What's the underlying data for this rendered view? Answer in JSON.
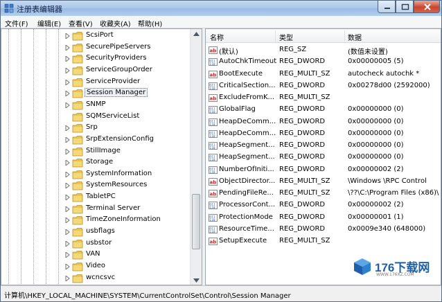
{
  "window": {
    "title": "注册表编辑器"
  },
  "menu": [
    "文件(F)",
    "编辑(E)",
    "查看(V)",
    "收藏夹(A)",
    "帮助(H)"
  ],
  "tree": {
    "selected": "Session Manager",
    "items": [
      {
        "label": "ScsiPort",
        "expandable": true
      },
      {
        "label": "SecurePipeServers",
        "expandable": true
      },
      {
        "label": "SecurityProviders",
        "expandable": true
      },
      {
        "label": "ServiceGroupOrder",
        "expandable": true
      },
      {
        "label": "ServiceProvider",
        "expandable": true
      },
      {
        "label": "Session Manager",
        "expandable": true
      },
      {
        "label": "SNMP",
        "expandable": true
      },
      {
        "label": "SQMServiceList",
        "expandable": false
      },
      {
        "label": "Srp",
        "expandable": true
      },
      {
        "label": "SrpExtensionConfig",
        "expandable": true
      },
      {
        "label": "StillImage",
        "expandable": true
      },
      {
        "label": "Storage",
        "expandable": true
      },
      {
        "label": "SystemInformation",
        "expandable": true
      },
      {
        "label": "SystemResources",
        "expandable": true
      },
      {
        "label": "TabletPC",
        "expandable": true
      },
      {
        "label": "Terminal Server",
        "expandable": true
      },
      {
        "label": "TimeZoneInformation",
        "expandable": true
      },
      {
        "label": "usbflags",
        "expandable": true
      },
      {
        "label": "usbstor",
        "expandable": true
      },
      {
        "label": "VAN",
        "expandable": true
      },
      {
        "label": "Video",
        "expandable": true
      },
      {
        "label": "wcncsvc",
        "expandable": true
      }
    ]
  },
  "list": {
    "columns": {
      "name": "名称",
      "type": "类型",
      "data": "数据"
    },
    "rows": [
      {
        "icon": "string",
        "name": "(默认)",
        "type": "REG_SZ",
        "data": "(数值未设置)"
      },
      {
        "icon": "binary",
        "name": "AutoChkTimeout",
        "type": "REG_DWORD",
        "data": "0x00000005 (5)"
      },
      {
        "icon": "string",
        "name": "BootExecute",
        "type": "REG_MULTI_SZ",
        "data": "autocheck autochk *"
      },
      {
        "icon": "binary",
        "name": "CriticalSection...",
        "type": "REG_DWORD",
        "data": "0x00278d00 (2592000)"
      },
      {
        "icon": "string",
        "name": "ExcludeFromK...",
        "type": "REG_MULTI_SZ",
        "data": ""
      },
      {
        "icon": "binary",
        "name": "GlobalFlag",
        "type": "REG_DWORD",
        "data": "0x00000000 (0)"
      },
      {
        "icon": "binary",
        "name": "HeapDeComm...",
        "type": "REG_DWORD",
        "data": "0x00000000 (0)"
      },
      {
        "icon": "binary",
        "name": "HeapDeComm...",
        "type": "REG_DWORD",
        "data": "0x00000000 (0)"
      },
      {
        "icon": "binary",
        "name": "HeapSegment...",
        "type": "REG_DWORD",
        "data": "0x00000000 (0)"
      },
      {
        "icon": "binary",
        "name": "HeapSegment...",
        "type": "REG_DWORD",
        "data": "0x00000000 (0)"
      },
      {
        "icon": "binary",
        "name": "NumberOfIniti...",
        "type": "REG_DWORD",
        "data": "0x00000002 (2)"
      },
      {
        "icon": "string",
        "name": "ObjectDirector...",
        "type": "REG_MULTI_SZ",
        "data": "\\Windows \\RPC Control"
      },
      {
        "icon": "string",
        "name": "PendingFileRe...",
        "type": "REG_MULTI_SZ",
        "data": "\\??\\C:\\Program Files (x86)\\"
      },
      {
        "icon": "binary",
        "name": "ProcessorCont...",
        "type": "REG_DWORD",
        "data": "0x00000002 (2)"
      },
      {
        "icon": "binary",
        "name": "ProtectionMode",
        "type": "REG_DWORD",
        "data": "0x00000001 (1)"
      },
      {
        "icon": "binary",
        "name": "ResourceTime...",
        "type": "REG_DWORD",
        "data": "0x0009e340 (648000)"
      },
      {
        "icon": "string",
        "name": "SetupExecute",
        "type": "REG_MULTI_SZ",
        "data": ""
      }
    ]
  },
  "status": "计算机\\HKEY_LOCAL_MACHINE\\SYSTEM\\CurrentControlSet\\Control\\Session Manager",
  "watermark": {
    "text": "176下载网",
    "url": "WWW.176XZ.COM"
  },
  "colors": {
    "folder": "#e8c453",
    "selection_border": "#666666",
    "titlebar": "#a9c6e8"
  }
}
